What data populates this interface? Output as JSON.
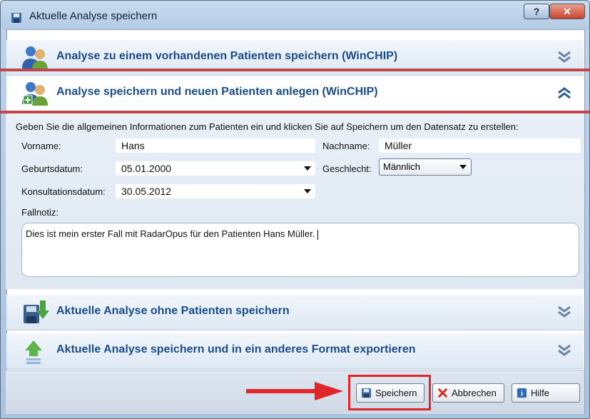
{
  "window": {
    "title": "Aktuelle Analyse speichern",
    "help_label": "?",
    "close_label": "✕"
  },
  "sections": {
    "existing_patient": "Analyse zu einem vorhandenen Patienten speichern (WinCHIP)",
    "new_patient": "Analyse speichern und neuen Patienten anlegen (WinCHIP)",
    "without_patient": "Aktuelle Analyse ohne Patienten speichern",
    "export": "Aktuelle Analyse speichern und in ein anderes Format exportieren"
  },
  "form": {
    "instructions": "Geben Sie die allgemeinen Informationen zum Patienten ein und klicken Sie auf Speichern um den Datensatz zu erstellen:",
    "vorname_label": "Vorname:",
    "vorname_value": "Hans",
    "nachname_label": "Nachname:",
    "nachname_value": "Müller",
    "geburtsdatum_label": "Geburtsdatum:",
    "geburtsdatum_value": "05.01.2000",
    "geschlecht_label": "Geschlecht:",
    "geschlecht_value": "Männlich",
    "konsultationsdatum_label": "Konsultationsdatum:",
    "konsultationsdatum_value": "30.05.2012",
    "fallnotiz_label": "Fallnotiz:",
    "fallnotiz_value": "Dies ist mein erster Fall mit RadarOpus  für den Patienten Hans Müller."
  },
  "buttons": {
    "save": "Speichern",
    "cancel": "Abbrechen",
    "help": "Hilfe"
  },
  "colors": {
    "annotation_red": "#e0262b",
    "section_title_blue": "#1b4c8c",
    "redline": "#c0474b"
  }
}
